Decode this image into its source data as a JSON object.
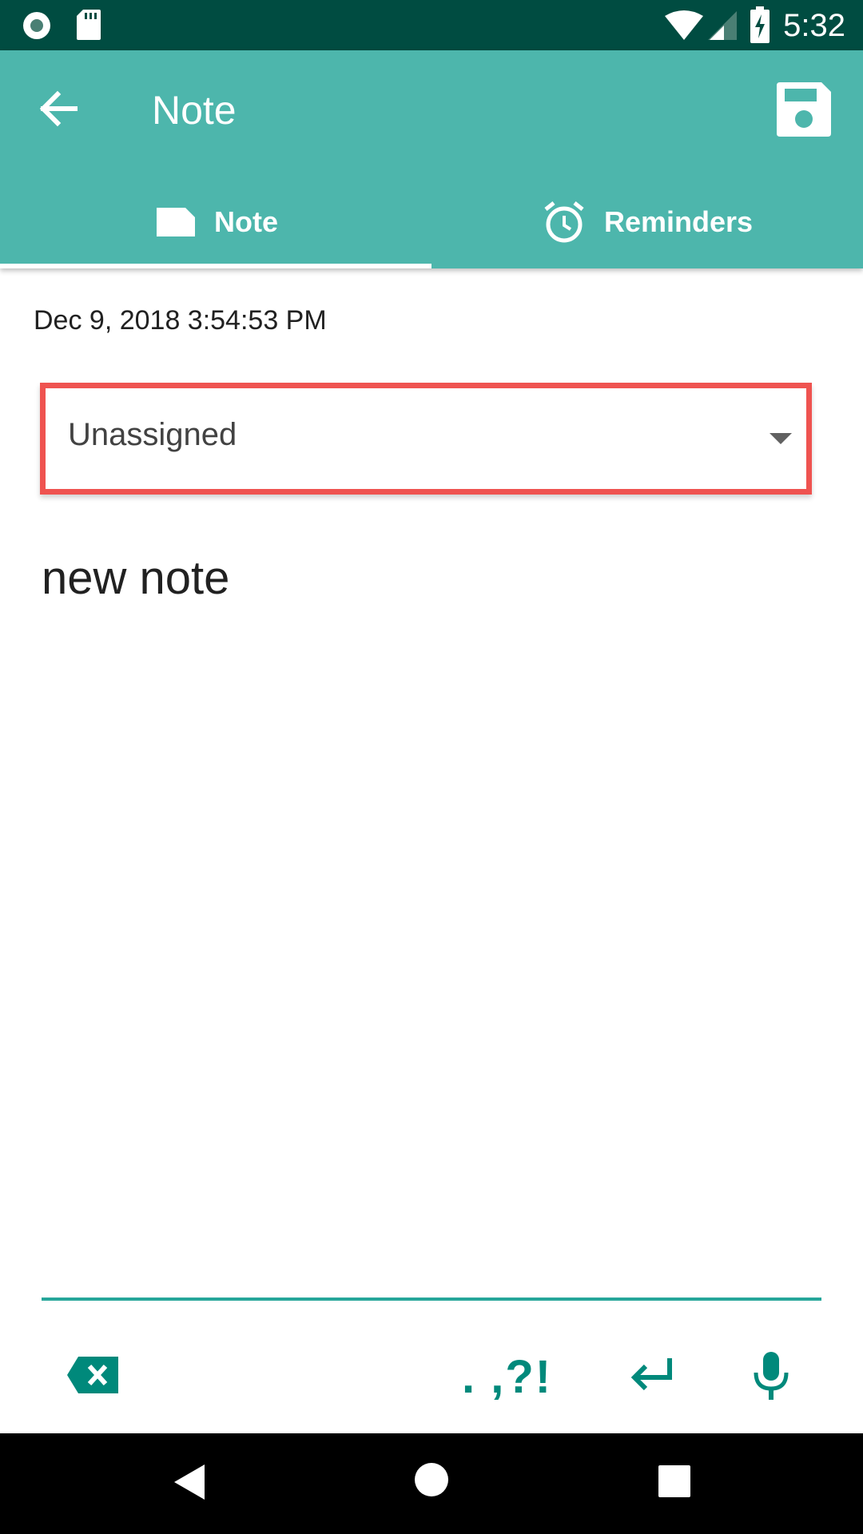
{
  "status_bar": {
    "time": "5:32",
    "icons": [
      "record-icon",
      "sd-card-icon",
      "wifi-icon",
      "signal-icon",
      "battery-charging-icon"
    ]
  },
  "app_bar": {
    "title": "Note",
    "back_icon": "arrow-back-icon",
    "save_icon": "save-icon"
  },
  "tabs": [
    {
      "label": "Note",
      "icon": "note-icon",
      "selected": true
    },
    {
      "label": "Reminders",
      "icon": "alarm-clock-icon",
      "selected": false
    }
  ],
  "content": {
    "date": "Dec 9, 2018 3:54:53 PM",
    "category_dropdown": {
      "selected": "Unassigned"
    },
    "note_text": "new note"
  },
  "keyboard_toolbar": {
    "punctuation_label": ". ,?!",
    "icons": [
      "backspace-icon",
      "enter-icon",
      "microphone-icon"
    ]
  },
  "nav_bar": {
    "icons": [
      "back-triangle-icon",
      "home-circle-icon",
      "recents-square-icon"
    ]
  },
  "colors": {
    "status_bar": "#004c41",
    "app_bar": "#4db6ac",
    "accent": "#26a69a",
    "highlight_border": "#ef5350"
  }
}
